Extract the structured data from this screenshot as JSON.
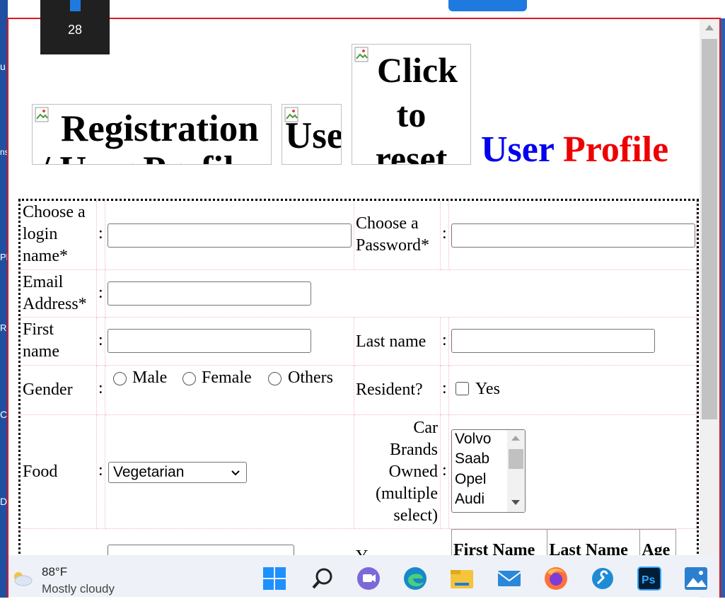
{
  "desktop": {
    "edge_letters": [
      "u",
      "ns",
      "Ph",
      "Re",
      "C",
      "D"
    ]
  },
  "calendar_tile": {
    "day": "28"
  },
  "header": {
    "img1_alt_line1": "Registration",
    "img1_alt_line2": "/ User Profile",
    "img2_alt": "Use",
    "img3_alt_line1": "Click",
    "img3_alt_line2": "to",
    "img3_alt_line3": "reset",
    "title_part1": "User",
    "title_part2": "Profile"
  },
  "form": {
    "login_label_l1": "Choose a",
    "login_label_l2": "login",
    "login_label_l3": "name*",
    "password_label_l1": "Choose a",
    "password_label_l2": "Password*",
    "email_label_l1": "Email",
    "email_label_l2": "Address*",
    "first_label_l1": "First",
    "first_label_l2": "name",
    "last_label": "Last name",
    "gender_label": "Gender",
    "gender_options": [
      "Male",
      "Female",
      "Others"
    ],
    "resident_label": "Resident?",
    "resident_option": "Yes",
    "food_label": "Food",
    "food_selected": "Vegetarian",
    "car_label_l1": "Car",
    "car_label_l2": "Brands",
    "car_label_l3": "Owned",
    "car_label_l4": "(multiple",
    "car_label_l5": "select)",
    "car_options": [
      "Volvo",
      "Saab",
      "Opel",
      "Audi"
    ],
    "colon": ":",
    "partial_label": "Y",
    "inner_table_headers": [
      "First Name",
      "Last Name",
      "Age"
    ]
  },
  "taskbar": {
    "temperature": "88°F",
    "condition": "Mostly cloudy",
    "icons": [
      "start-icon",
      "search-icon",
      "teams-chat-icon",
      "edge-icon",
      "file-explorer-icon",
      "mail-icon",
      "firefox-icon",
      "settings-tool-icon",
      "photoshop-icon",
      "photos-icon"
    ]
  },
  "colors": {
    "border_red": "#e0161d",
    "title_blue": "#0000ee",
    "title_red": "#ee0000",
    "accent_blue": "#1f7ae0"
  }
}
